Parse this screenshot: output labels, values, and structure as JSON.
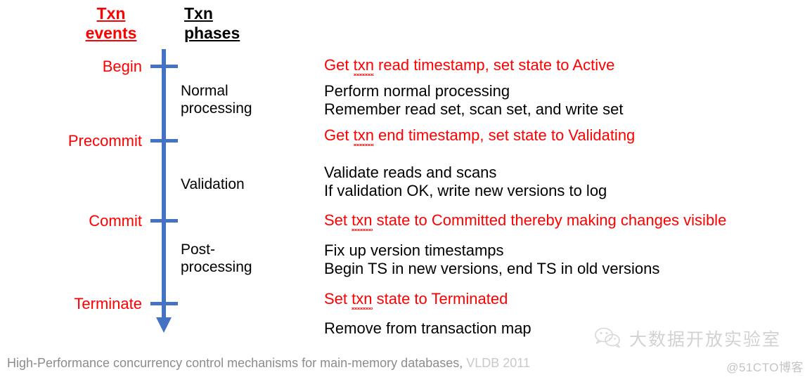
{
  "headers": {
    "events": {
      "line1": "Txn",
      "line2": "events",
      "color": "#ff0000"
    },
    "phases": {
      "line1": "Txn",
      "line2": "phases",
      "color": "#000000"
    }
  },
  "timeline": {
    "color": "#4472c4",
    "events": [
      {
        "label": "Begin"
      },
      {
        "label": "Precommit"
      },
      {
        "label": "Commit"
      },
      {
        "label": "Terminate"
      }
    ],
    "phases": [
      {
        "line1": "Normal",
        "line2": "processing"
      },
      {
        "line1": "Validation",
        "line2": ""
      },
      {
        "line1": "Post-",
        "line2": "processing"
      }
    ]
  },
  "descriptions": [
    {
      "style": "red",
      "lines": [
        {
          "pre": "Get ",
          "misspelled": "txn",
          "post": " read timestamp, set state to Active"
        }
      ]
    },
    {
      "style": "black",
      "lines": [
        {
          "pre": "Perform normal processing",
          "misspelled": "",
          "post": ""
        },
        {
          "pre": "Remember read set, scan set, and write set",
          "misspelled": "",
          "post": ""
        }
      ]
    },
    {
      "style": "red",
      "lines": [
        {
          "pre": "Get ",
          "misspelled": "txn",
          "post": " end timestamp, set state to Validating"
        }
      ]
    },
    {
      "style": "black",
      "lines": [
        {
          "pre": "Validate reads and scans",
          "misspelled": "",
          "post": ""
        },
        {
          "pre": "If validation OK, write new versions to log",
          "misspelled": "",
          "post": ""
        }
      ]
    },
    {
      "style": "red",
      "lines": [
        {
          "pre": "Set ",
          "misspelled": "txn",
          "post": " state to Committed thereby making changes visible"
        }
      ]
    },
    {
      "style": "black",
      "lines": [
        {
          "pre": "Fix up version timestamps",
          "misspelled": "",
          "post": ""
        },
        {
          "pre": "Begin TS in new versions, end TS in old versions",
          "misspelled": "",
          "post": ""
        }
      ]
    },
    {
      "style": "red",
      "lines": [
        {
          "pre": "Set ",
          "misspelled": "txn",
          "post": " state to Terminated"
        }
      ]
    },
    {
      "style": "black",
      "lines": [
        {
          "pre": "Remove from transaction map",
          "misspelled": "",
          "post": ""
        }
      ]
    }
  ],
  "citation": {
    "title": "High-Performance concurrency control mechanisms for main-memory databases,",
    "venue": "VLDB 2011"
  },
  "watermark": {
    "brand": "大数据开放实验室",
    "icon": "wechat-icon",
    "site": "@51CTO博客"
  }
}
